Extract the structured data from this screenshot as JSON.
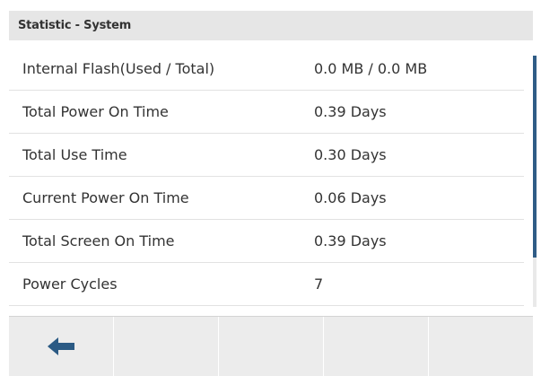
{
  "title": "Statistic - System",
  "rows": [
    {
      "label": "Internal Flash(Used / Total)",
      "value": "0.0 MB / 0.0 MB"
    },
    {
      "label": "Total Power On Time",
      "value": "0.39 Days"
    },
    {
      "label": "Total Use Time",
      "value": "0.30 Days"
    },
    {
      "label": "Current Power On Time",
      "value": "0.06 Days"
    },
    {
      "label": "Total Screen On Time",
      "value": "0.39 Days"
    },
    {
      "label": "Power Cycles",
      "value": "7"
    }
  ],
  "softkeys": [
    {
      "icon": "back-arrow-icon"
    },
    {
      "icon": ""
    },
    {
      "icon": ""
    },
    {
      "icon": ""
    },
    {
      "icon": ""
    }
  ],
  "colors": {
    "title_bar_bg": "#e6e6e6",
    "softkey_bg": "#ececec",
    "scroll_thumb": "#2f5c86",
    "arrow_icon": "#2b5a84",
    "text": "#333333"
  }
}
